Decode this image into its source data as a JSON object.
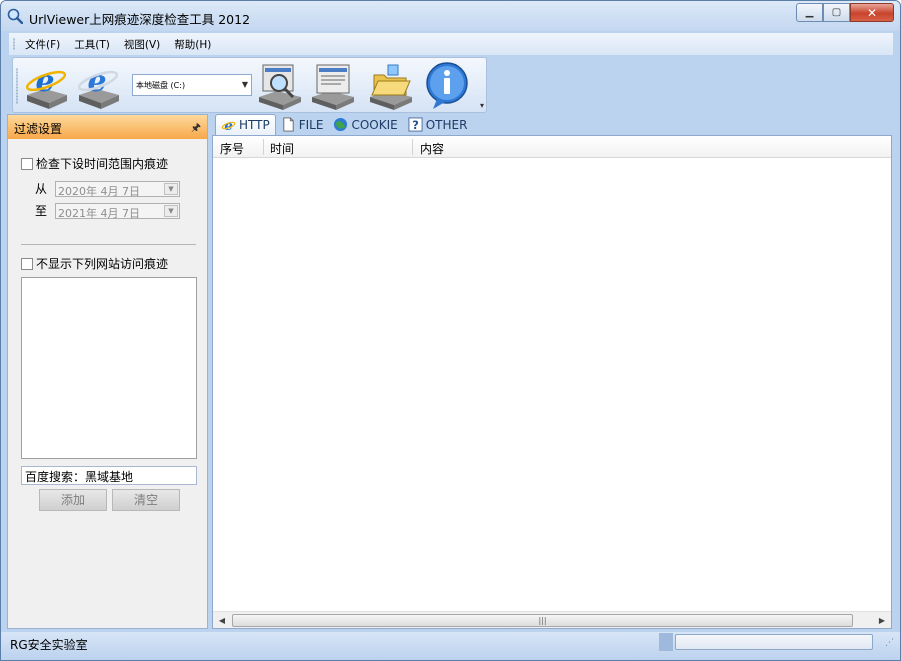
{
  "window": {
    "title": "UrlViewer上网痕迹深度检查工具 2012"
  },
  "menu": [
    "文件(F)",
    "工具(T)",
    "视图(V)",
    "帮助(H)"
  ],
  "toolbar": {
    "drive_value": "本地磁盘 (C:)",
    "buttons": [
      "ie-scan-icon",
      "ie-clean-icon",
      "search-drive-icon",
      "report-drive-icon",
      "open-folder-icon",
      "info-icon"
    ]
  },
  "filter_panel": {
    "title": "过滤设置",
    "time_range_label": "检查下设时间范围内痕迹",
    "from_label": "从",
    "from_date": "2020年 4月 7日",
    "to_label": "至",
    "to_date": "2021年 4月 7日",
    "exclude_sites_label": "不显示下列网站访问痕迹",
    "site_input_value": "百度搜索：黑域基地",
    "add_button": "添加",
    "clear_button": "清空"
  },
  "tabs": [
    {
      "label": "HTTP",
      "icon": "ie-icon",
      "active": true
    },
    {
      "label": "FILE",
      "icon": "file-icon",
      "active": false
    },
    {
      "label": "COOKIE",
      "icon": "cookie-icon",
      "active": false
    },
    {
      "label": "OTHER",
      "icon": "help-icon",
      "active": false
    }
  ],
  "table": {
    "columns": [
      "序号",
      "时间",
      "内容"
    ],
    "rows": []
  },
  "status": {
    "text": "RG安全实验室"
  }
}
